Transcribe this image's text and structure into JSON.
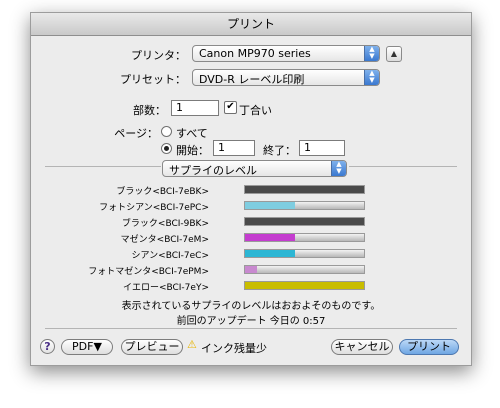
{
  "window": {
    "title": "プリント"
  },
  "printer": {
    "label": "プリンタ：",
    "value": "Canon MP970 series"
  },
  "preset": {
    "label": "プリセット：",
    "value": "DVD-R レーベル印刷"
  },
  "copies": {
    "label": "部数：",
    "value": "1",
    "collate_label": "丁合い"
  },
  "pages": {
    "label": "ページ：",
    "all_label": "すべて",
    "from_label": "開始：",
    "from_value": "1",
    "to_label": "終了：",
    "to_value": "1"
  },
  "panel_select": {
    "value": "サプライのレベル"
  },
  "inks": [
    {
      "label": "ブラック<BCI-7eBK>",
      "level": 1.0,
      "color": "#4a4a4a"
    },
    {
      "label": "フォトシアン<BCI-7ePC>",
      "level": 0.42,
      "color": "#7fcde0"
    },
    {
      "label": "ブラック<BCI-9BK>",
      "level": 1.0,
      "color": "#4a4a4a"
    },
    {
      "label": "マゼンタ<BCI-7eM>",
      "level": 0.42,
      "color": "#c43ccf"
    },
    {
      "label": "シアン<BCI-7eC>",
      "level": 0.42,
      "color": "#2cb6d4"
    },
    {
      "label": "フォトマゼンタ<BCI-7ePM>",
      "level": 0.1,
      "color": "#c889cf"
    },
    {
      "label": "イエロー<BCI-7eY>",
      "level": 1.0,
      "color": "#c9bd00"
    }
  ],
  "notes": {
    "approx": "表示されているサプライのレベルはおおよそのものです。",
    "updated": "前回のアップデート 今日の 0:57"
  },
  "footer": {
    "help": "?",
    "pdf": "PDF▼",
    "preview": "プレビュー",
    "warning": "インク残量少",
    "cancel": "キャンセル",
    "print": "プリント"
  }
}
